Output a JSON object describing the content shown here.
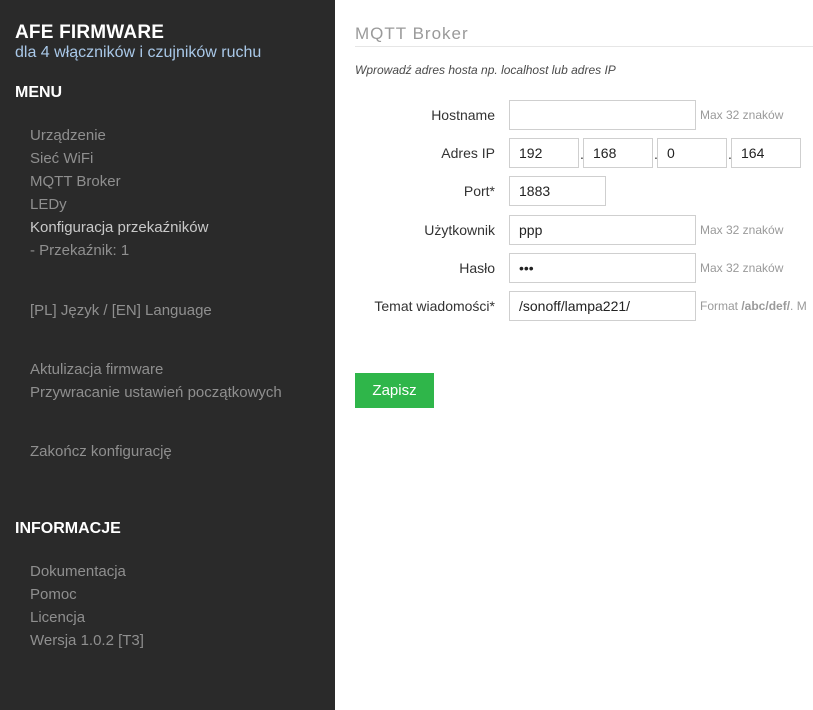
{
  "sidebar": {
    "brand_title": "AFE FIRMWARE",
    "brand_subtitle": "dla 4 włączników i czujników ruchu",
    "menu_title": "MENU",
    "menu_items": [
      "Urządzenie",
      "Sieć WiFi",
      "MQTT Broker",
      "LEDy",
      "Konfiguracja przekaźników",
      "- Przekaźnik: 1",
      "[PL] Język / [EN] Language",
      "Aktulizacja firmware",
      "Przywracanie ustawień początkowych",
      "Zakończ konfigurację"
    ],
    "info_title": "INFORMACJE",
    "info_items": [
      "Dokumentacja",
      "Pomoc",
      "Licencja",
      "Wersja 1.0.2 [T3]"
    ]
  },
  "main": {
    "title": "MQTT Broker",
    "hint": "Wprowadź adres hosta np. localhost lub adres IP",
    "form": {
      "hostname": {
        "label": "Hostname",
        "value": "",
        "note": "Max 32 znaków"
      },
      "ip": {
        "label": "Adres IP",
        "octets": [
          "192",
          "168",
          "0",
          "164"
        ],
        "separator": "."
      },
      "port": {
        "label": "Port*",
        "value": "1883"
      },
      "user": {
        "label": "Użytkownik",
        "value": "ppp",
        "note": "Max 32 znaków"
      },
      "password": {
        "label": "Hasło",
        "value": "•••",
        "note": "Max 32 znaków"
      },
      "topic": {
        "label": "Temat wiadomości*",
        "value": "/sonoff/lampa221/",
        "note_prefix": "Format ",
        "note_bold": "/abc/def/",
        "note_suffix": ". M"
      }
    },
    "save_label": "Zapisz"
  },
  "colors": {
    "sidebar_bg": "#2a2a2a",
    "brand_subtitle": "#a9c8e8",
    "save_button": "#2fb64a"
  }
}
